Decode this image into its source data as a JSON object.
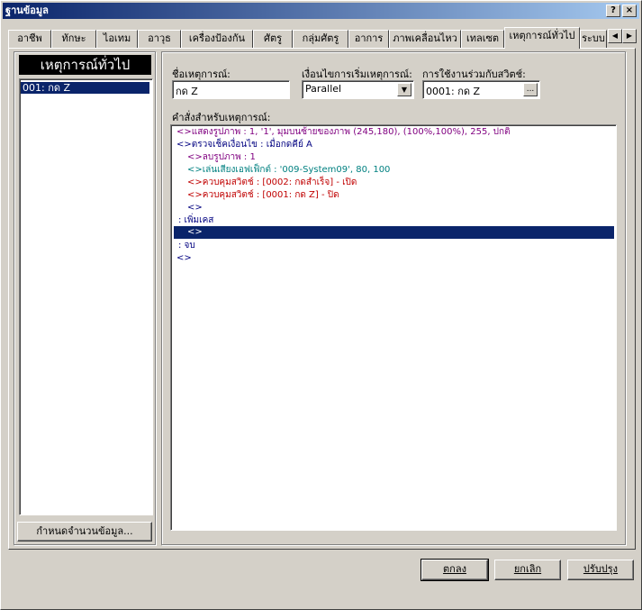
{
  "window": {
    "title": "ฐานข้อมูล",
    "help_label": "?",
    "close_label": "×"
  },
  "tabs": [
    {
      "label": "อาชีพ"
    },
    {
      "label": "ทักษะ"
    },
    {
      "label": "ไอเทม"
    },
    {
      "label": "อาวุธ"
    },
    {
      "label": "เครื่องป้องกัน"
    },
    {
      "label": "ศัตรู"
    },
    {
      "label": "กลุ่มศัตรู"
    },
    {
      "label": "อาการ"
    },
    {
      "label": "ภาพเคลื่อนไหว"
    },
    {
      "label": "เทลเซต"
    },
    {
      "label": "เหตุการณ์ทั่วไป"
    },
    {
      "label": "ระบบ"
    }
  ],
  "tab_scroll": {
    "left": "◀",
    "right": "▶"
  },
  "left_panel": {
    "header": "เหตุการณ์ทั่วไป",
    "items": [
      "001: กด Z"
    ],
    "change_max_button": "กำหนดจำนวนข้อมูล..."
  },
  "event": {
    "name_label": "ชื่อเหตุการณ์:",
    "name_value": "กด Z",
    "trigger_label": "เงื่อนไขการเริ่มเหตุการณ์:",
    "trigger_value": "Parallel",
    "switch_label": "การใช้งานร่วมกับสวิตช์:",
    "switch_value": "0001: กด Z",
    "switch_button": "...",
    "commands_label": "คำสั่งสำหรับเหตุการณ์:"
  },
  "commands": [
    {
      "text": "<>แสดงรูปภาพ : 1, '1', มุมบนซ้ายของภาพ (245,180), (100%,100%), 255, ปกติ",
      "color": "#800080"
    },
    {
      "text": "<>ตรวจเช็คเงื่อนไข : เมื่อกดคีย์ A",
      "color": "#000080"
    },
    {
      "text": "<>ลบรูปภาพ : 1",
      "color": "#800080"
    },
    {
      "text": "<>เล่นเสียงเอฟเฟ็กต์ : '009-System09', 80, 100",
      "color": "#008080"
    },
    {
      "text": "<>ควบคุมสวิตช์ : [0002: กดสำเร็จ] - เปิด",
      "color": "#c00000"
    },
    {
      "text": "<>ควบคุมสวิตช์ : [0001: กด Z] - ปิด",
      "color": "#c00000"
    },
    {
      "text": "<>",
      "color": "#000080"
    },
    {
      "text": ": เพิ่มเคส",
      "color": "#000080"
    },
    {
      "text": "<>",
      "color": "#ffffff"
    },
    {
      "text": ": จบ",
      "color": "#000080"
    },
    {
      "text": "<>",
      "color": "#000080"
    }
  ],
  "footer": {
    "ok": "ตกลง",
    "cancel": "ยกเลิก",
    "apply": "ปรับปรุง"
  }
}
